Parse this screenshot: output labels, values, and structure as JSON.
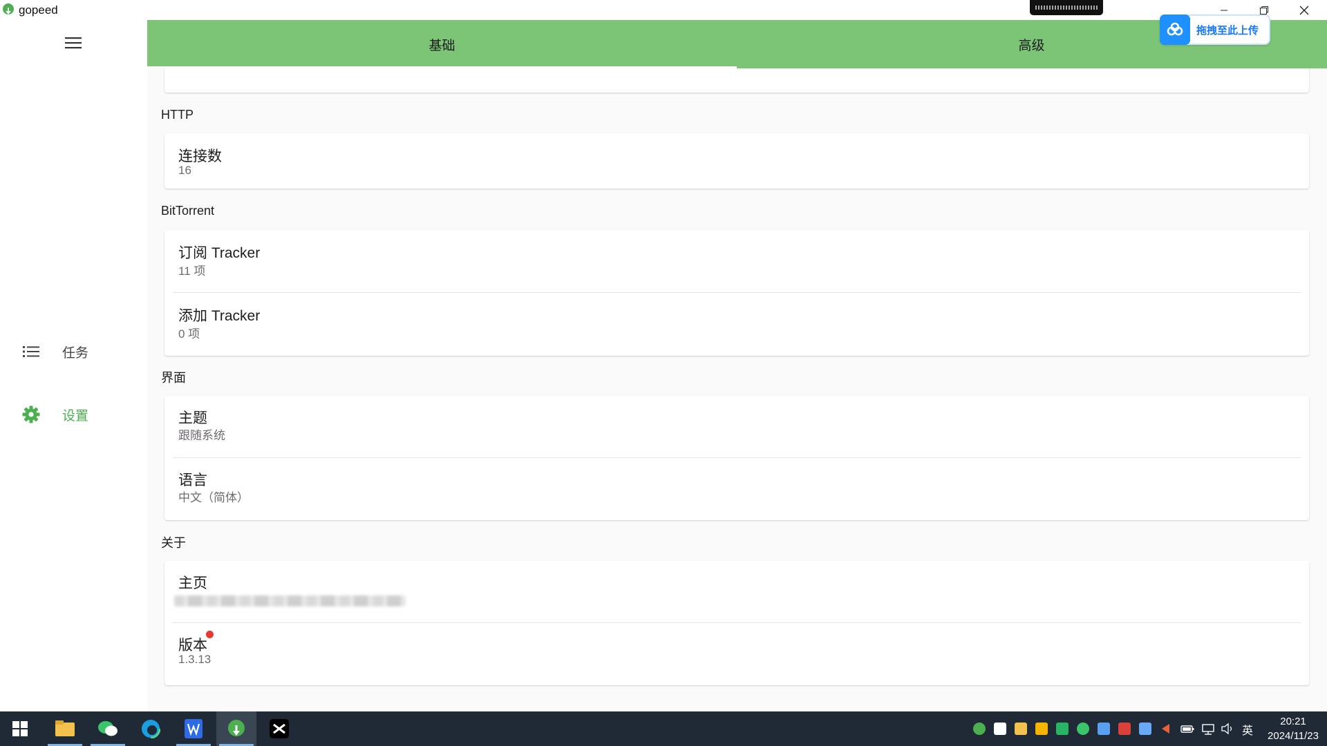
{
  "app": {
    "title": "gopeed"
  },
  "upload_widget": {
    "label": "拖拽至此上传"
  },
  "sidebar": {
    "items": [
      {
        "label": "任务",
        "icon": "list-icon",
        "active": false
      },
      {
        "label": "设置",
        "icon": "gear-icon",
        "active": true
      }
    ]
  },
  "tabs": [
    {
      "label": "基础",
      "active": true
    },
    {
      "label": "高级",
      "active": false
    }
  ],
  "sections": {
    "http": {
      "title": "HTTP",
      "rows": [
        {
          "title": "连接数",
          "value": "16"
        }
      ]
    },
    "bittorrent": {
      "title": "BitTorrent",
      "rows": [
        {
          "title": "订阅 Tracker",
          "value": "11 项"
        },
        {
          "title": "添加 Tracker",
          "value": "0 项"
        }
      ]
    },
    "ui": {
      "title": "界面",
      "rows": [
        {
          "title": "主题",
          "value": "跟随系统"
        },
        {
          "title": "语言",
          "value": "中文（简体）"
        }
      ]
    },
    "about": {
      "title": "关于",
      "rows": [
        {
          "title": "主页",
          "value": ""
        },
        {
          "title": "版本",
          "value": "1.3.13"
        }
      ]
    }
  },
  "taskbar": {
    "input_method": "英",
    "time": "20:21",
    "date": "2024/11/23"
  },
  "colors": {
    "accent": "#7cc576",
    "active_nav": "#4caf50",
    "badge": "#e53935",
    "taskbar": "#1f2a36"
  }
}
